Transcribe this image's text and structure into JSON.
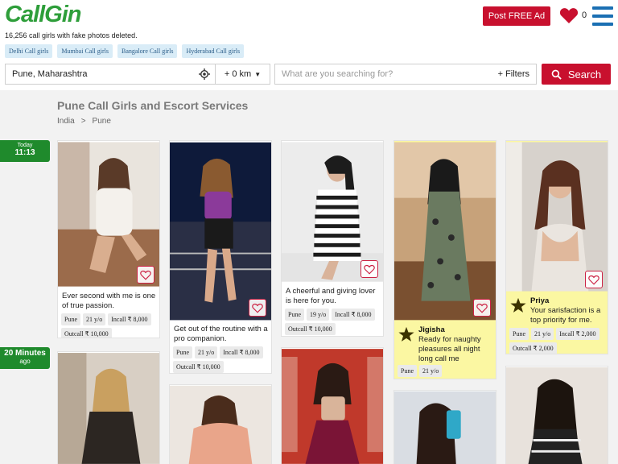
{
  "brand": {
    "logo": "CallGin",
    "tagline": "16,256 call girls with fake photos deleted."
  },
  "quick_links": [
    "Delhi Call girls",
    "Mumbai Call girls",
    "Bangalore Call girls",
    "Hyderabad Call girls"
  ],
  "header": {
    "post_button": "Post FREE Ad",
    "favorites_count": "0",
    "accent": "#c8102e",
    "brand_green": "#2e9e3a",
    "menu_color": "#1a6fb3"
  },
  "search": {
    "location_value": "Pune, Maharashtra",
    "distance_value": "+ 0 km",
    "query_placeholder": "What are you searching for?",
    "filters_label": "+ Filters",
    "button_label": "Search"
  },
  "page": {
    "title": "Pune Call Girls and Escort Services",
    "breadcrumb": [
      "India",
      ">",
      "Pune"
    ]
  },
  "time_markers": [
    {
      "label_top": "Today",
      "label_main": "11:13"
    },
    {
      "label_top": "20 Minutes",
      "label_main": "ago"
    }
  ],
  "listings": [
    {
      "description": "Ever second with me is one of true passion.",
      "tags": [
        "Pune",
        "21 y/o",
        "Incall ₹ 8,000",
        "Outcall ₹ 10,000"
      ],
      "photo_colors": [
        "#c9b7a8",
        "#f2efe9",
        "#7a5a44"
      ]
    },
    {
      "description": "Get out of the routine with a pro companion.",
      "tags": [
        "Pune",
        "21 y/o",
        "Incall ₹ 8,000",
        "Outcall ₹ 10,000"
      ],
      "photo_colors": [
        "#0e1a3a",
        "#8b3a9a",
        "#c58b6a"
      ]
    },
    {
      "description": "A cheerful and giving lover is here for you.",
      "tags": [
        "Pune",
        "19 y/o",
        "Incall ₹ 8,000",
        "Outcall ₹ 10,000"
      ],
      "photo_colors": [
        "#e8e8e8",
        "#222222",
        "#d9b39a"
      ]
    },
    {
      "name": "Jigisha",
      "description": "Ready for naughty pleasures all night long call me",
      "tags": [
        "Pune",
        "21 y/o"
      ],
      "featured": true,
      "photo_colors": [
        "#c08a5a",
        "#6a7a60",
        "#e2c7a8"
      ]
    },
    {
      "name": "Priya",
      "description": "Your sarisfaction is a top priority for me.",
      "tags": [
        "Pune",
        "21 y/o",
        "Incall ₹ 2,000",
        "Outcall ₹ 2,000"
      ],
      "featured": true,
      "photo_colors": [
        "#d7d2cc",
        "#b88a70",
        "#eae5df"
      ]
    }
  ],
  "icons": {
    "location": "crosshair-icon",
    "heart": "heart-icon",
    "star": "star-icon",
    "search": "search-icon",
    "menu": "menu-icon"
  }
}
